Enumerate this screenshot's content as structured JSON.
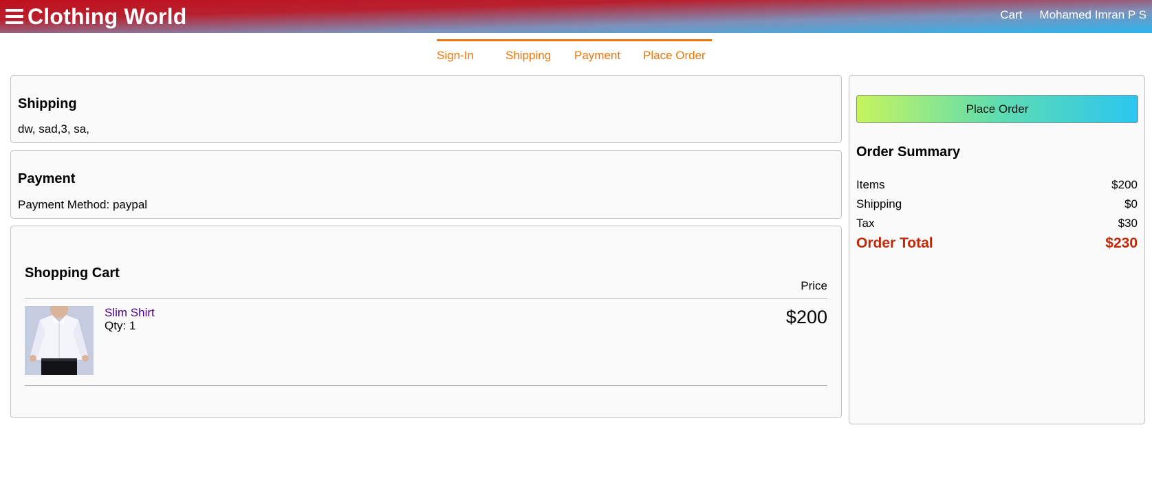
{
  "header": {
    "brand": "Clothing World",
    "links": {
      "cart": "Cart",
      "user": "Mohamed Imran P S"
    }
  },
  "checkout_steps": [
    "Sign-In",
    "Shipping",
    "Payment",
    "Place Order"
  ],
  "shipping": {
    "title": "Shipping",
    "address": "dw, sad,3, sa,"
  },
  "payment": {
    "title": "Payment",
    "method_text": "Payment Method: paypal"
  },
  "cart": {
    "title": "Shopping Cart",
    "price_header": "Price",
    "items": [
      {
        "name": "Slim Shirt",
        "qty": "Qty: 1",
        "price": "$200"
      }
    ]
  },
  "summary": {
    "button_label": "Place Order",
    "title": "Order Summary",
    "rows": [
      {
        "label": "Items",
        "value": "$200"
      },
      {
        "label": "Shipping",
        "value": "$0"
      },
      {
        "label": "Tax",
        "value": "$30"
      }
    ],
    "total": {
      "label": "Order Total",
      "value": "$230"
    }
  },
  "colors": {
    "accent": "#f0750a",
    "total": "#c0280a",
    "product_link": "#4b0082"
  }
}
